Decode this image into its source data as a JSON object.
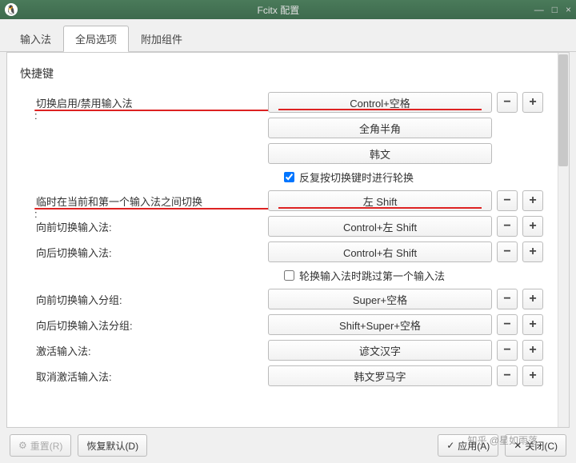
{
  "window": {
    "title": "Fcitx 配置",
    "minimize": "—",
    "maximize": "□",
    "close": "×"
  },
  "tabs": {
    "input_method": "输入法",
    "global_options": "全局选项",
    "addons": "附加组件"
  },
  "section": {
    "shortcuts": "快捷键"
  },
  "labels": {
    "toggle_enable": "切换启用/禁用输入法",
    "temp_switch": "临时在当前和第一个输入法之间切换",
    "forward": "向前切换输入法",
    "backward": "向后切换输入法",
    "forward_group": "向前切换输入分组",
    "backward_group": "向后切换输入法分组",
    "activate": "激活输入法",
    "deactivate": "取消激活输入法"
  },
  "hotkeys": {
    "ctrl_space": "Control+空格",
    "full_half": "全角半角",
    "hangul": "韩文",
    "left_shift": "左 Shift",
    "ctrl_left_shift": "Control+左 Shift",
    "ctrl_right_shift": "Control+右 Shift",
    "super_space": "Super+空格",
    "shift_super_space": "Shift+Super+空格",
    "hanja": "谚文汉字",
    "romaja": "韩文罗马字"
  },
  "checkboxes": {
    "repeat_toggle": "反复按切换键时进行轮换",
    "skip_first": "轮换输入法时跳过第一个输入法"
  },
  "buttons": {
    "reset": "重置(R)",
    "restore_default": "恢复默认(D)",
    "apply": "应用(A)",
    "close": "关闭(C)"
  },
  "watermark": "知乎 @星如雨落",
  "glyphs": {
    "minus": "−",
    "plus": "+",
    "check": "✓",
    "x": "✕",
    "gear": "⚙"
  }
}
